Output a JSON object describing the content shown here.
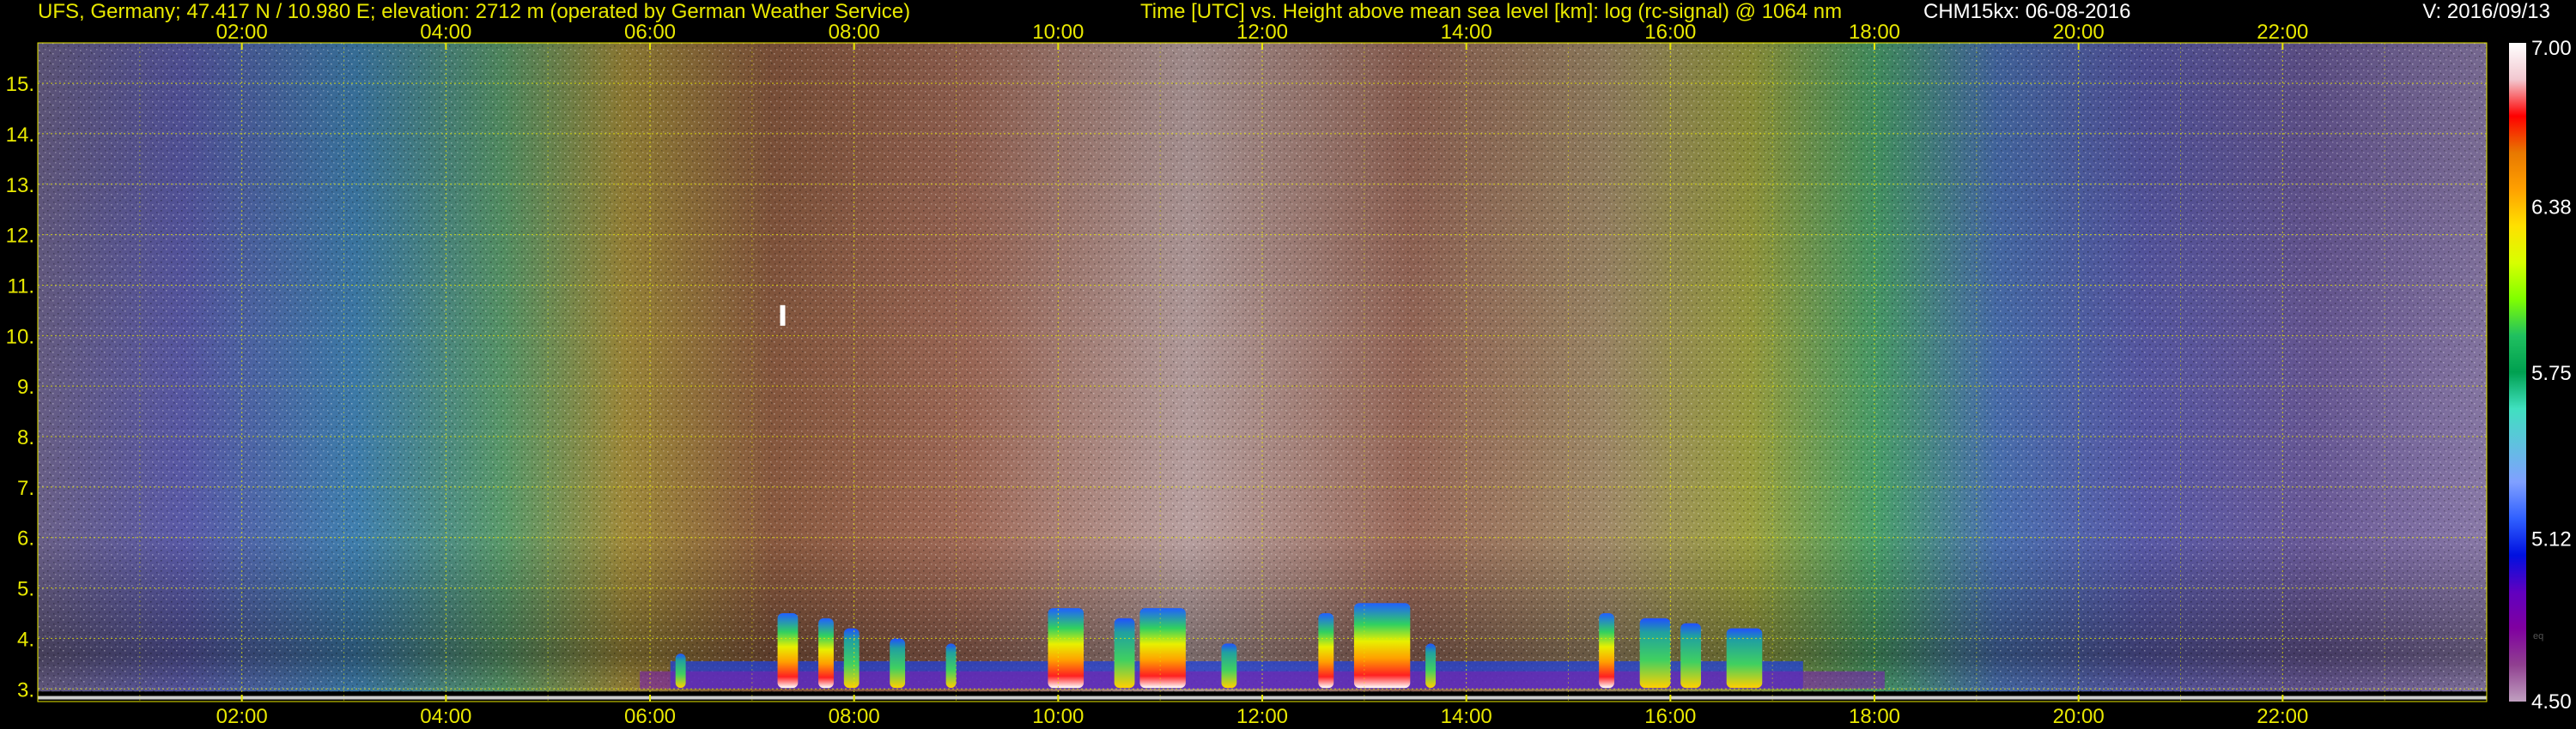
{
  "header": {
    "station": "UFS, Germany; 47.417 N / 10.980 E; elevation: 2712 m  (operated by German Weather Service)",
    "axes_description": "Time [UTC] vs. Height above mean sea level [km]: log (rc-signal) @ 1064 nm",
    "instrument_date": "CHM15kx: 06-08-2016",
    "version": "V: 2016/09/13"
  },
  "chart_data": {
    "type": "heatmap",
    "title": "Time [UTC] vs. Height above mean sea level [km]: log (rc-signal) @ 1064 nm",
    "x_ticks": [
      "02:00",
      "04:00",
      "06:00",
      "08:00",
      "10:00",
      "12:00",
      "14:00",
      "16:00",
      "18:00",
      "20:00",
      "22:00"
    ],
    "x_tick_hours": [
      2,
      4,
      6,
      8,
      10,
      12,
      14,
      16,
      18,
      20,
      22
    ],
    "xlim_hours": [
      0,
      24
    ],
    "y_ticks": [
      "3.",
      "4.",
      "5.",
      "6.",
      "7.",
      "8.",
      "9.",
      "10.",
      "11.",
      "12.",
      "13.",
      "14.",
      "15."
    ],
    "y_tick_values": [
      3,
      4,
      5,
      6,
      7,
      8,
      9,
      10,
      11,
      12,
      13,
      14,
      15
    ],
    "ylim_km": [
      2.75,
      15.8
    ],
    "grid": true,
    "colorbar": {
      "ticks": [
        "7.00",
        "6.38",
        "5.75",
        "5.12",
        "4.50"
      ],
      "tick_values": [
        7.0,
        6.38,
        5.75,
        5.12,
        4.5
      ],
      "range": [
        4.5,
        7.0
      ],
      "small_label": "eq",
      "colors": [
        "#ffffff",
        "#f2c8d0",
        "#ff0000",
        "#e87800",
        "#ffa000",
        "#ffe000",
        "#d8ff00",
        "#80ff00",
        "#20c060",
        "#00a050",
        "#40e0c0",
        "#60c0e0",
        "#80a0ff",
        "#3060ff",
        "#0010e0",
        "#6000c0",
        "#8000a0",
        "#904090",
        "#c0a0c0"
      ]
    },
    "aerosol_plumes": [
      {
        "start": 6.25,
        "end": 6.35,
        "top": 3.7,
        "intensity": 0.5
      },
      {
        "start": 7.25,
        "end": 7.45,
        "top": 4.5,
        "intensity": 0.9
      },
      {
        "start": 7.65,
        "end": 7.8,
        "top": 4.4,
        "intensity": 0.9
      },
      {
        "start": 7.9,
        "end": 8.05,
        "top": 4.2,
        "intensity": 0.8
      },
      {
        "start": 8.35,
        "end": 8.5,
        "top": 4.0,
        "intensity": 0.8
      },
      {
        "start": 8.9,
        "end": 9.0,
        "top": 3.9,
        "intensity": 0.7
      },
      {
        "start": 9.9,
        "end": 10.25,
        "top": 4.6,
        "intensity": 1.0
      },
      {
        "start": 10.55,
        "end": 10.75,
        "top": 4.4,
        "intensity": 0.8
      },
      {
        "start": 10.8,
        "end": 11.25,
        "top": 4.6,
        "intensity": 1.0
      },
      {
        "start": 11.6,
        "end": 11.75,
        "top": 3.9,
        "intensity": 0.7
      },
      {
        "start": 12.55,
        "end": 12.7,
        "top": 4.5,
        "intensity": 1.0
      },
      {
        "start": 12.9,
        "end": 13.45,
        "top": 4.7,
        "intensity": 1.0
      },
      {
        "start": 13.6,
        "end": 13.7,
        "top": 3.9,
        "intensity": 0.6
      },
      {
        "start": 15.3,
        "end": 15.45,
        "top": 4.5,
        "intensity": 0.9
      },
      {
        "start": 15.7,
        "end": 16.0,
        "top": 4.4,
        "intensity": 0.8
      },
      {
        "start": 16.1,
        "end": 16.3,
        "top": 4.3,
        "intensity": 0.7
      },
      {
        "start": 16.55,
        "end": 16.9,
        "top": 4.2,
        "intensity": 0.7
      }
    ],
    "cirrus_mark": {
      "hour": 7.3,
      "height_km": 10.4
    }
  }
}
